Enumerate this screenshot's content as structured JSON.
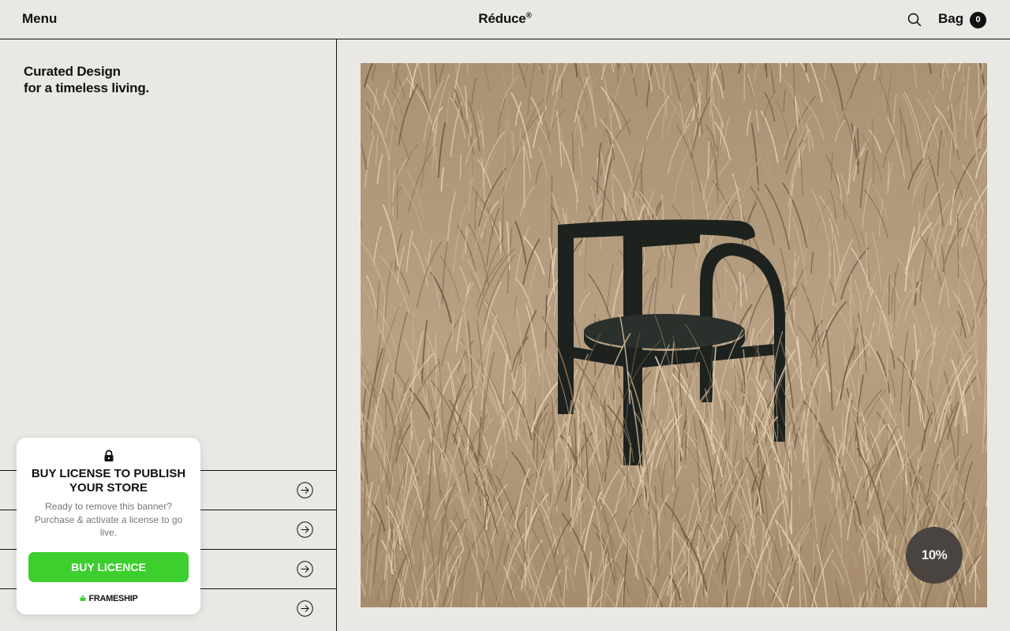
{
  "header": {
    "menu_label": "Menu",
    "brand": "Réduce",
    "brand_mark": "®",
    "bag_label": "Bag",
    "bag_count": "0"
  },
  "left": {
    "tagline_line1": "Curated Design",
    "tagline_line2": "for a timeless living."
  },
  "nav_rows": [
    {
      "label": "",
      "icon": "arrow-right-circle-icon"
    },
    {
      "label": "",
      "icon": "arrow-right-circle-icon"
    },
    {
      "label": "",
      "icon": "arrow-right-circle-icon"
    },
    {
      "label": "",
      "icon": "arrow-right-circle-icon"
    }
  ],
  "hero": {
    "image": "black wooden chair in dry grass field",
    "discount_badge": "10%"
  },
  "license_banner": {
    "icon": "lock-icon",
    "title": "BUY LICENSE TO PUBLISH YOUR STORE",
    "text": "Ready to remove this banner? Purchase & activate a license to go live.",
    "button_label": "BUY LICENCE",
    "brand": "FRAMESHIP",
    "button_color": "#3ccf2e"
  },
  "colors": {
    "background": "#eae8e4",
    "ink": "#111111",
    "badge": "#4a4440"
  }
}
